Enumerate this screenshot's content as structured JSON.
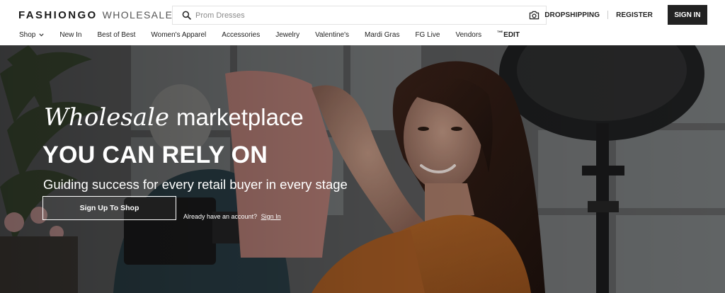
{
  "header": {
    "logo_main": "FASHIONGO",
    "logo_sub": "WHOLESALE",
    "search_placeholder": "Prom Dresses",
    "links": {
      "dropshipping": "DROPSHIPPING",
      "register": "REGISTER",
      "sign_in": "SIGN IN"
    }
  },
  "nav": {
    "items": [
      {
        "label": "Shop"
      },
      {
        "label": "New In"
      },
      {
        "label": "Best of Best"
      },
      {
        "label": "Women's Apparel"
      },
      {
        "label": "Accessories"
      },
      {
        "label": "Jewelry"
      },
      {
        "label": "Valentine's"
      },
      {
        "label": "Mardi Gras"
      },
      {
        "label": "FG Live"
      },
      {
        "label": "Vendors"
      }
    ],
    "edit_small": "THE",
    "edit_label": "EDIT"
  },
  "hero": {
    "headline_script": "Wholesale",
    "headline_rest": "marketplace",
    "headline_bold": "YOU CAN RELY ON",
    "subheadline": "Guiding success for every retail buyer in every stage",
    "cta_label": "Sign Up To Shop",
    "account_prompt": "Already have an account?",
    "account_link": "Sign In"
  },
  "colors": {
    "accent": "#222222",
    "hero_overlay": "#3f3f40",
    "jacket": "#d4762b"
  },
  "icons": {
    "search": "search-icon",
    "camera": "camera-icon",
    "chevron": "chevron-down-icon"
  }
}
